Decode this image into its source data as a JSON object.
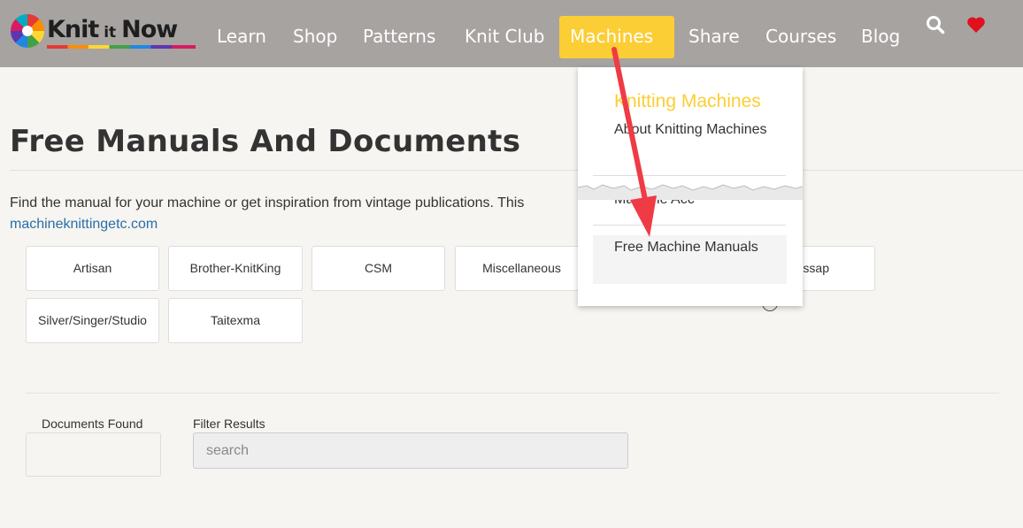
{
  "header": {
    "logo": {
      "text_main": "Knit",
      "text_small": "it",
      "text_end": "Now"
    },
    "nav": [
      {
        "label": "Learn"
      },
      {
        "label": "Shop"
      },
      {
        "label": "Patterns"
      },
      {
        "label": "Knit Club"
      },
      {
        "label": "Machines"
      },
      {
        "label": "Share"
      },
      {
        "label": "Courses"
      },
      {
        "label": "Blog"
      }
    ],
    "active_nav": "Machines",
    "icons": [
      "search-icon",
      "heart-icon"
    ],
    "colors": {
      "header_bg": "#a7a3a1",
      "accent": "#fcce35",
      "heart": "#e0101e"
    }
  },
  "dropdown": {
    "heading": "Knitting Machines",
    "items": [
      {
        "label": "About Knitting Machines"
      },
      {
        "label": "Machine Acc"
      },
      {
        "label": "Free Machine Manuals"
      }
    ]
  },
  "page": {
    "title": "Free Manuals And Documents",
    "intro": "Find the manual for your machine or get inspiration from vintage publications. This",
    "intro_link": "machineknittingetc.com",
    "brands": [
      {
        "label": "Artisan"
      },
      {
        "label": "Brother-KnitKing"
      },
      {
        "label": "CSM"
      },
      {
        "label": "Miscellaneous"
      },
      {
        "label": "ssap"
      },
      {
        "label": "Silver/Singer/Studio"
      },
      {
        "label": "Taitexma"
      }
    ],
    "documents_found_label": "Documents Found",
    "filter_label": "Filter Results",
    "filter_placeholder": "search"
  }
}
